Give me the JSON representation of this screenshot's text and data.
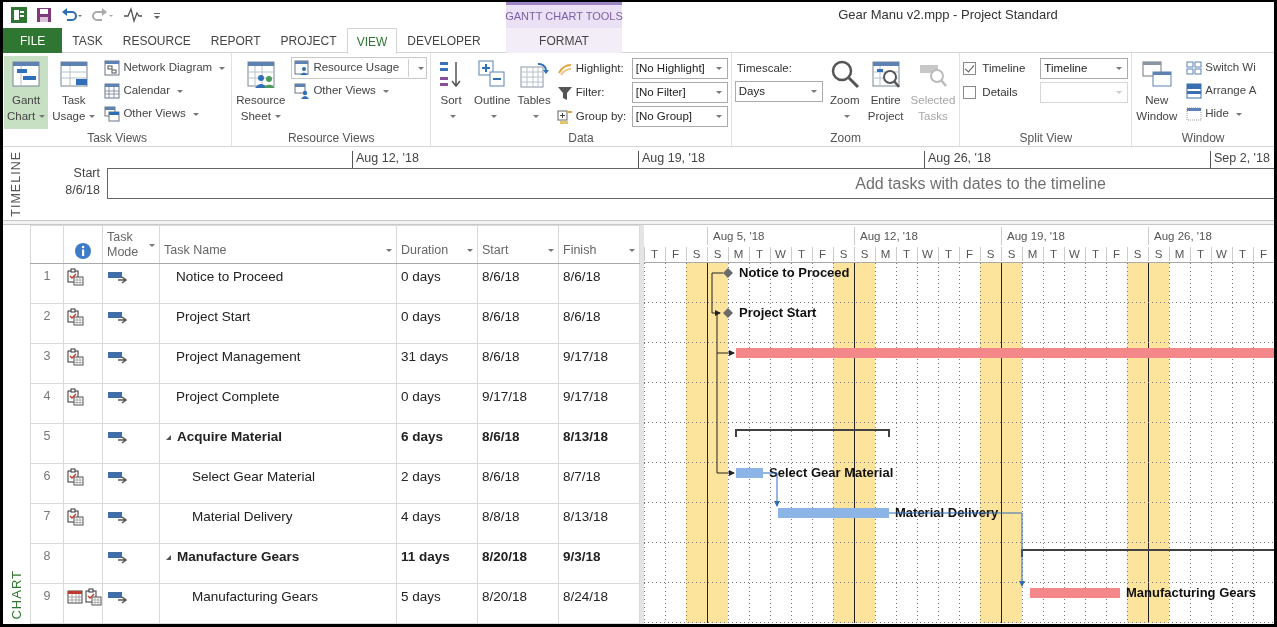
{
  "window": {
    "title": "Gear Manu v2.mpp - Project Standard"
  },
  "contextual_group": {
    "label": "GANTT CHART TOOLS"
  },
  "tabs": [
    {
      "label": "FILE",
      "kind": "file",
      "selected": false
    },
    {
      "label": "TASK",
      "kind": "normal",
      "selected": false
    },
    {
      "label": "RESOURCE",
      "kind": "normal",
      "selected": false
    },
    {
      "label": "REPORT",
      "kind": "normal",
      "selected": false
    },
    {
      "label": "PROJECT",
      "kind": "normal",
      "selected": false
    },
    {
      "label": "VIEW",
      "kind": "normal",
      "selected": true
    },
    {
      "label": "DEVELOPER",
      "kind": "normal",
      "selected": false
    },
    {
      "label": "FORMAT",
      "kind": "contextual",
      "selected": false
    }
  ],
  "ribbon_groups": [
    {
      "label": "Task Views",
      "items": [
        {
          "kind": "large",
          "label": "Gantt Chart",
          "menu": true,
          "selected": true
        },
        {
          "kind": "large",
          "label": "Task Usage",
          "menu": true,
          "selected": false
        },
        {
          "kind": "small",
          "label": "Network Diagram",
          "menu": true,
          "selected": false
        },
        {
          "kind": "small",
          "label": "Calendar",
          "menu": true,
          "selected": false
        },
        {
          "kind": "small",
          "label": "Other Views",
          "menu": true,
          "selected": false
        }
      ]
    },
    {
      "label": "Resource Views",
      "items": [
        {
          "kind": "large",
          "label": "Resource Sheet",
          "menu": true,
          "selected": false
        },
        {
          "kind": "split",
          "label": "Resource Usage",
          "menu": true,
          "selected": true
        },
        {
          "kind": "small",
          "label": "Other Views",
          "menu": true,
          "selected": false
        }
      ]
    },
    {
      "label": "Data",
      "items": [
        {
          "kind": "large",
          "label": "Sort",
          "menu": true
        },
        {
          "kind": "large",
          "label": "Outline",
          "menu": true
        },
        {
          "kind": "large",
          "label": "Tables",
          "menu": true
        },
        {
          "kind": "field",
          "label": "Highlight:",
          "value": "[No Highlight]"
        },
        {
          "kind": "field",
          "label": "Filter:",
          "value": "[No Filter]"
        },
        {
          "kind": "field",
          "label": "Group by:",
          "value": "[No Group]"
        }
      ]
    },
    {
      "label": "Zoom",
      "items": [
        {
          "kind": "caption",
          "label": "Timescale:"
        },
        {
          "kind": "select",
          "value": "Days"
        },
        {
          "kind": "large",
          "label": "Zoom",
          "menu": true,
          "disabled": false
        },
        {
          "kind": "large",
          "label": "Entire Project",
          "menu": false,
          "disabled": false
        },
        {
          "kind": "large",
          "label": "Selected Tasks",
          "menu": false,
          "disabled": true
        }
      ]
    },
    {
      "label": "Split View",
      "items": [
        {
          "kind": "check",
          "label": "Timeline",
          "checked": true,
          "value": "Timeline",
          "disabled": false
        },
        {
          "kind": "check",
          "label": "Details",
          "checked": false,
          "disabled": true
        }
      ]
    },
    {
      "label": "Window",
      "items": [
        {
          "kind": "large",
          "label": "New Window",
          "menu": false
        },
        {
          "kind": "small",
          "label": "Switch Wi",
          "menu": false
        },
        {
          "kind": "small",
          "label": "Arrange A",
          "menu": false
        },
        {
          "kind": "small",
          "label": "Hide",
          "menu": true
        }
      ]
    }
  ],
  "timeline": {
    "side_label": "TIMELINE",
    "start_label": "Start",
    "start_date": "8/6/18",
    "dates": [
      "Aug 12, '18",
      "Aug 19, '18",
      "Aug 26, '18",
      "Sep 2, '18"
    ],
    "message": "Add tasks with dates to the timeline"
  },
  "view_label": "CHART",
  "table": {
    "columns": [
      "Task Mode",
      "Task Name",
      "Duration",
      "Start",
      "Finish"
    ],
    "rows": [
      {
        "id": "1",
        "name": "Notice to Proceed",
        "duration": "0 days",
        "start": "8/6/18",
        "finish": "8/6/18",
        "constraint_indicator": true,
        "calendar_indicator": false,
        "bar": {
          "kind": "milestone",
          "label": "Notice to Proceed"
        }
      },
      {
        "id": "2",
        "name": "Project Start",
        "duration": "0 days",
        "start": "8/6/18",
        "finish": "8/6/18",
        "constraint_indicator": true,
        "calendar_indicator": false,
        "bar": {
          "kind": "milestone",
          "label": "Project Start"
        }
      },
      {
        "id": "3",
        "name": "Project Management",
        "duration": "31 days",
        "start": "8/6/18",
        "finish": "9/17/18",
        "constraint_indicator": true,
        "calendar_indicator": false,
        "bar": {
          "kind": "task",
          "color": "#f4878a"
        }
      },
      {
        "id": "4",
        "name": "Project Complete",
        "duration": "0 days",
        "start": "9/17/18",
        "finish": "9/17/18",
        "constraint_indicator": true,
        "calendar_indicator": false
      },
      {
        "id": "5",
        "name": "Acquire Material",
        "duration": "6 days",
        "start": "8/6/18",
        "finish": "8/13/18",
        "constraint_indicator": false,
        "calendar_indicator": false,
        "expanded": true,
        "bar": {
          "kind": "summary"
        },
        "children": [
          {
            "id": "6",
            "name": "Select Gear Material",
            "duration": "2 days",
            "start": "8/6/18",
            "finish": "8/7/18",
            "constraint_indicator": true,
            "calendar_indicator": false,
            "bar": {
              "kind": "task",
              "color": "#8cb4e6",
              "label": "Select Gear Material"
            }
          },
          {
            "id": "7",
            "name": "Material Delivery",
            "duration": "4 days",
            "start": "8/8/18",
            "finish": "8/13/18",
            "constraint_indicator": true,
            "calendar_indicator": false,
            "bar": {
              "kind": "task",
              "color": "#8cb4e6",
              "label": "Material Delivery"
            }
          }
        ]
      },
      {
        "id": "8",
        "name": "Manufacture Gears",
        "duration": "11 days",
        "start": "8/20/18",
        "finish": "9/3/18",
        "constraint_indicator": false,
        "calendar_indicator": false,
        "expanded": true,
        "bar": {
          "kind": "summary"
        },
        "children": [
          {
            "id": "9",
            "name": "Manufacturing Gears",
            "duration": "5 days",
            "start": "8/20/18",
            "finish": "8/24/18",
            "constraint_indicator": true,
            "calendar_indicator": true,
            "bar": {
              "kind": "task",
              "color": "#f4878a",
              "label": "Manufacturing Gears"
            }
          }
        ]
      }
    ]
  },
  "gantt": {
    "weeks": [
      {
        "days": [
          {
            "letter": "T",
            "weekend": false
          },
          {
            "letter": "F",
            "weekend": false
          },
          {
            "letter": "S",
            "weekend": true
          }
        ]
      },
      {
        "label": "Aug 5, '18",
        "days": [
          {
            "letter": "S",
            "weekend": true
          },
          {
            "letter": "M",
            "weekend": false
          },
          {
            "letter": "T",
            "weekend": false
          },
          {
            "letter": "W",
            "weekend": false
          },
          {
            "letter": "T",
            "weekend": false
          },
          {
            "letter": "F",
            "weekend": false
          },
          {
            "letter": "S",
            "weekend": true
          }
        ]
      },
      {
        "label": "Aug 12, '18",
        "days": [
          {
            "letter": "S",
            "weekend": true
          },
          {
            "letter": "M",
            "weekend": false
          },
          {
            "letter": "T",
            "weekend": false
          },
          {
            "letter": "W",
            "weekend": false
          },
          {
            "letter": "T",
            "weekend": false
          },
          {
            "letter": "F",
            "weekend": false
          },
          {
            "letter": "S",
            "weekend": true
          }
        ]
      },
      {
        "label": "Aug 19, '18",
        "days": [
          {
            "letter": "S",
            "weekend": true
          },
          {
            "letter": "M",
            "weekend": false
          },
          {
            "letter": "T",
            "weekend": false
          },
          {
            "letter": "W",
            "weekend": false
          },
          {
            "letter": "T",
            "weekend": false
          },
          {
            "letter": "F",
            "weekend": false
          },
          {
            "letter": "S",
            "weekend": true
          }
        ]
      },
      {
        "label": "Aug 26, '18",
        "days": [
          {
            "letter": "S",
            "weekend": true
          },
          {
            "letter": "M",
            "weekend": false
          },
          {
            "letter": "T",
            "weekend": false
          },
          {
            "letter": "W",
            "weekend": false
          },
          {
            "letter": "T",
            "weekend": false
          },
          {
            "letter": "F",
            "weekend": false
          }
        ]
      }
    ]
  }
}
